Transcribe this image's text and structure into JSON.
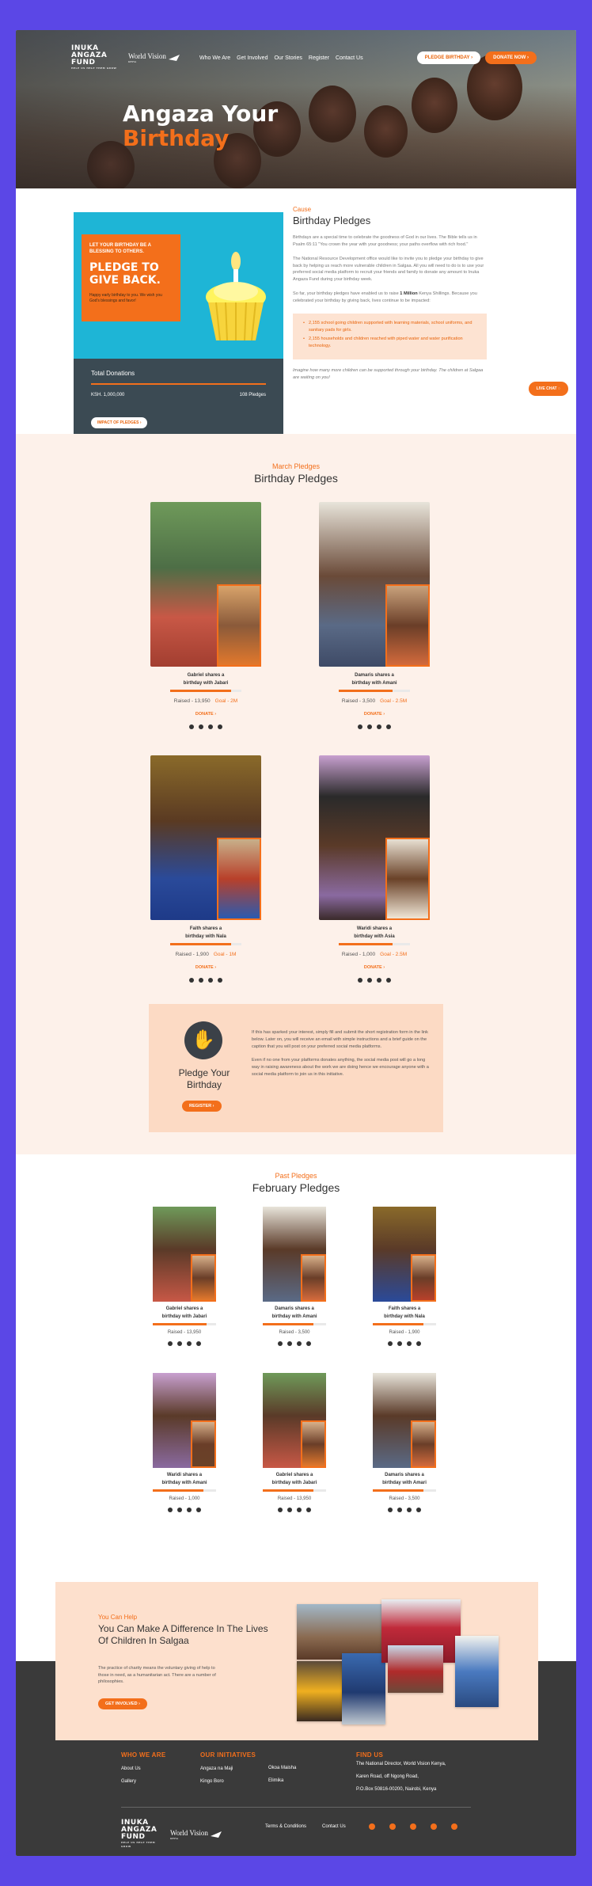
{
  "nav": {
    "logo_inuka": "INUKA",
    "logo_inuka_sub": "ANGAZA FUND",
    "logo_inuka_tag": "HELP US HELP THEM GROW",
    "logo_wv": "World Vision",
    "logo_wv_sub": "KENYA",
    "links": [
      "Who We Are",
      "Get Involved",
      "Our Stories",
      "Register",
      "Contact Us"
    ],
    "pledge_btn": "PLEDGE BIRTHDAY",
    "donate_btn": "DONATE NOW"
  },
  "hero": {
    "title_line1": "Angaza Your",
    "title_line2": "Birthday"
  },
  "cause": {
    "card": {
      "line1": "LET YOUR BIRTHDAY BE A BLESSING TO OTHERS.",
      "headline": "PLEDGE TO GIVE BACK.",
      "line3": "Happy early birthday to you. We wish you God's blessings and favor!",
      "total_label": "Total Donations",
      "amount": "KSH. 1,000,000",
      "pledges": "108 Pledges",
      "impact_btn": "IMPACT OF PLEDGES"
    },
    "eyebrow": "Cause",
    "title": "Birthday Pledges",
    "p1": "Birthdays are a special time to celebrate the goodness of God in our lives. The Bible tells us in Psalm 65:11 \"You crown the year with your goodness; your paths overflow with rich food.\"",
    "p2": "The National Resource Development office would like to invite you to pledge your birthday to give back by helping us reach more vulnerable children in Salgaa. All you will need to do is to use your preferred social media platform to recruit your friends and family to donate any amount to Inuka Angaza Fund during your birthday week.",
    "p3_a": "So far, your birthday pledges have enabled us to raise ",
    "p3_b": "1 Million",
    "p3_c": " Kenya Shillings. Because you celebrated your birthday by giving back, lives continue to be impacted:",
    "bullets": [
      "2,155 school going children supported with learning materials, school uniforms, and sanitary pads for girls.",
      "2,155 households and children reached with piped water and water purification technology."
    ],
    "note": "Imagine how many more children can be supported through your birthday. The children at Salgaa are waiting on you!"
  },
  "live_chat": "LIVE CHAT",
  "march": {
    "eyebrow": "March Pledges",
    "title": "Birthday Pledges",
    "cards": [
      {
        "line1": "Gabriel shares a",
        "line2": "birthday with Jabari",
        "raised": "Raised - 13,950",
        "goal": "Goal - 2M",
        "progress": 0.85
      },
      {
        "line1": "Damaris shares a",
        "line2": "birthday with Amani",
        "raised": "Raised - 3,500",
        "goal": "Goal - 2.5M",
        "progress": 0.75
      },
      {
        "line1": "Faith shares a",
        "line2": "birthday with Nala",
        "raised": "Raised - 1,900",
        "goal": "Goal - 1M",
        "progress": 0.85
      },
      {
        "line1": "Waridi shares a",
        "line2": "birthday with Asia",
        "raised": "Raised - 1,000",
        "goal": "Goal - 2.5M",
        "progress": 0.75
      }
    ],
    "donate": "DONATE"
  },
  "pledge_banner": {
    "title_line1": "Pledge Your",
    "title_line2": "Birthday",
    "button": "REGISTER",
    "p1": "If this has sparked your interest, simply fill and submit the short registration form in the link below. Later on, you will receive an email with simple instructions and a brief guide on the caption that you will post on your preferred social media platforms.",
    "p2": "Even if no one from your platforms donates anything, the social media post will go a long way in raising awareness about the work we are doing hence we encourage anyone with a social media platform to join us in this initiative."
  },
  "feb": {
    "eyebrow": "Past Pledges",
    "title": "February Pledges",
    "cards": [
      {
        "line1": "Gabriel shares a",
        "line2": "birthday with Jabari",
        "raised": "Raised - 13,950",
        "progress": 0.85
      },
      {
        "line1": "Damaris shares a",
        "line2": "birthday with Amani",
        "raised": "Raised - 3,500",
        "progress": 0.8
      },
      {
        "line1": "Faith shares a",
        "line2": "birthday with Nala",
        "raised": "Raised - 1,900",
        "progress": 0.8
      },
      {
        "line1": "Waridi shares a",
        "line2": "birthday with Amani",
        "raised": "Raised - 1,000",
        "progress": 0.8
      },
      {
        "line1": "Gabriel shares a",
        "line2": "birthday with Jabari",
        "raised": "Raised - 13,950",
        "progress": 0.8
      },
      {
        "line1": "Damaris shares a",
        "line2": "birthday with Amari",
        "raised": "Raised - 3,500",
        "progress": 0.8
      }
    ]
  },
  "help": {
    "eyebrow": "You Can Help",
    "title": "You Can Make A Difference In The Lives Of Children In Salgaa",
    "text": "The practice of charity means the voluntary giving of help to those in need, as a humanitarian act. There are a number of philosophies.",
    "button": "GET INVOLVED"
  },
  "footer": {
    "col1_title": "WHO WE ARE",
    "col1_links": [
      "About Us",
      "Gallery"
    ],
    "col2_title": "OUR INITIATIVES",
    "col2_links": [
      "Angaza na Maji",
      "Kingo Boro",
      "Okoa Maisha",
      "Elimika"
    ],
    "col3_title": "FIND US",
    "col3_lines": [
      "The National Director, World Vision Kenya,",
      "Karen Road, off Ngong Road,",
      "P.O.Box 50816-00200, Nairobi, Kenya"
    ],
    "terms": "Terms & Conditions",
    "contact": "Contact Us"
  },
  "colors": {
    "accent": "#f36f1b",
    "frame": "#5b47e6",
    "dark": "#3a3a3a",
    "peach": "#fdf1ea"
  }
}
